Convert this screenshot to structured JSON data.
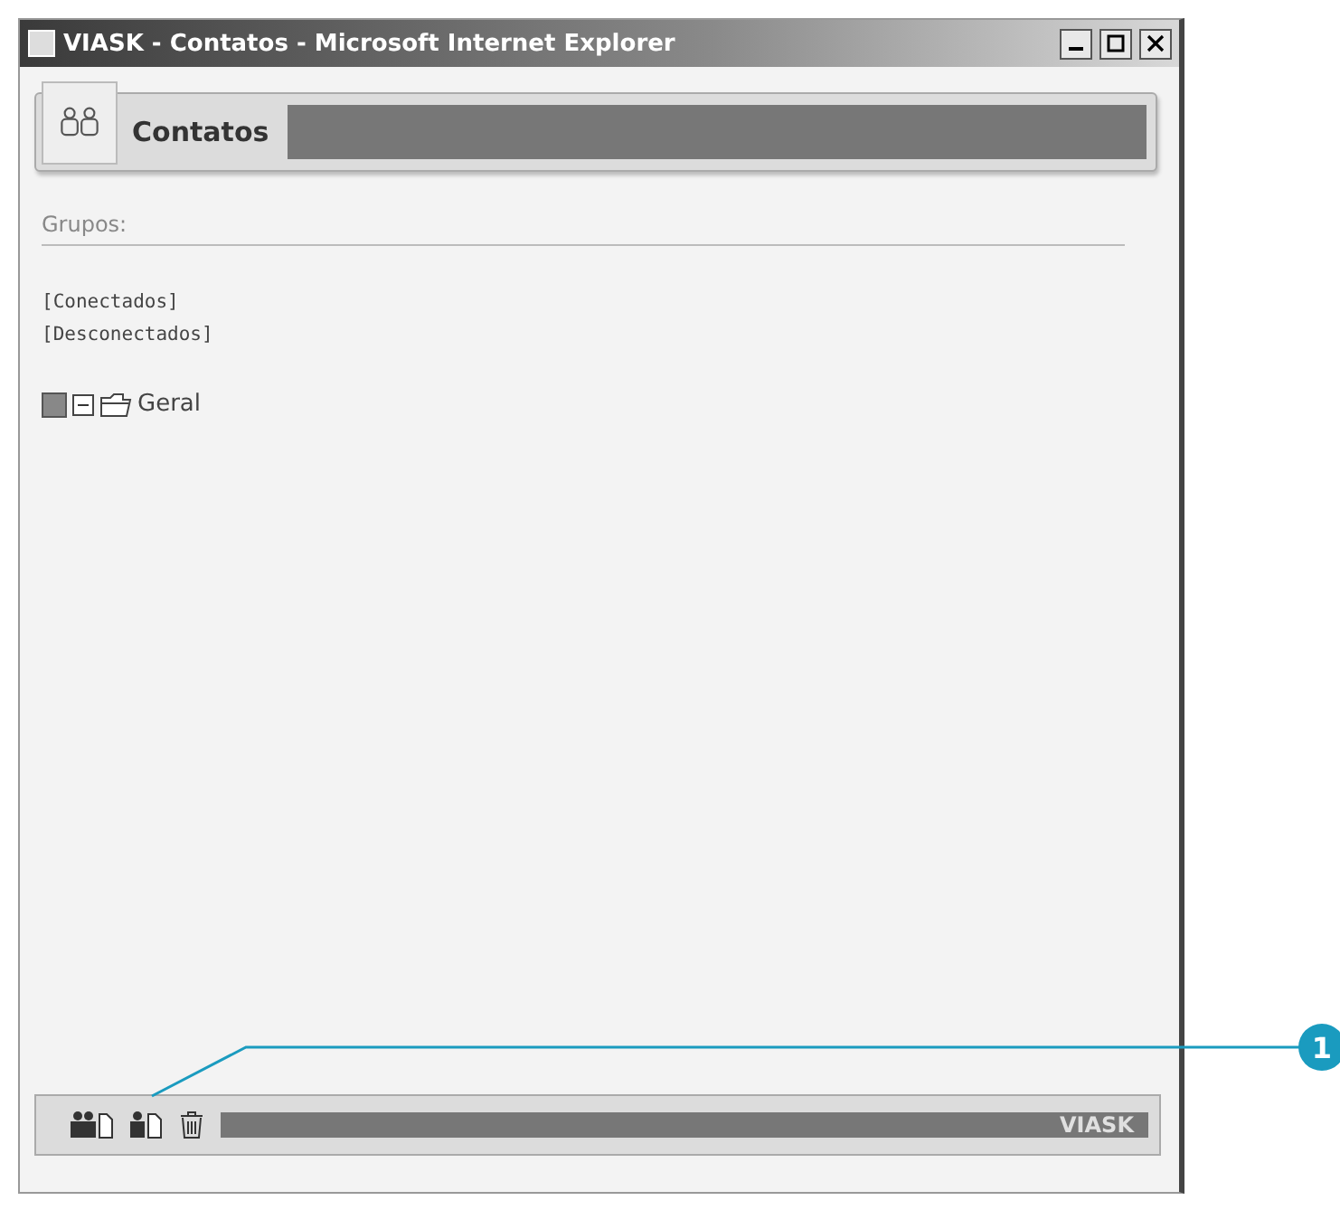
{
  "window": {
    "title": "VIASK - Contatos - Microsoft Internet Explorer"
  },
  "header": {
    "title": "Contatos"
  },
  "groups": {
    "label": "Grupos:",
    "filters": [
      "[Conectados]",
      "[Desconectados]"
    ],
    "tree": [
      {
        "label": "Geral",
        "checked": true,
        "expanded": true
      }
    ]
  },
  "footer": {
    "brand": "VIASK"
  },
  "callouts": [
    {
      "number": "1"
    }
  ]
}
